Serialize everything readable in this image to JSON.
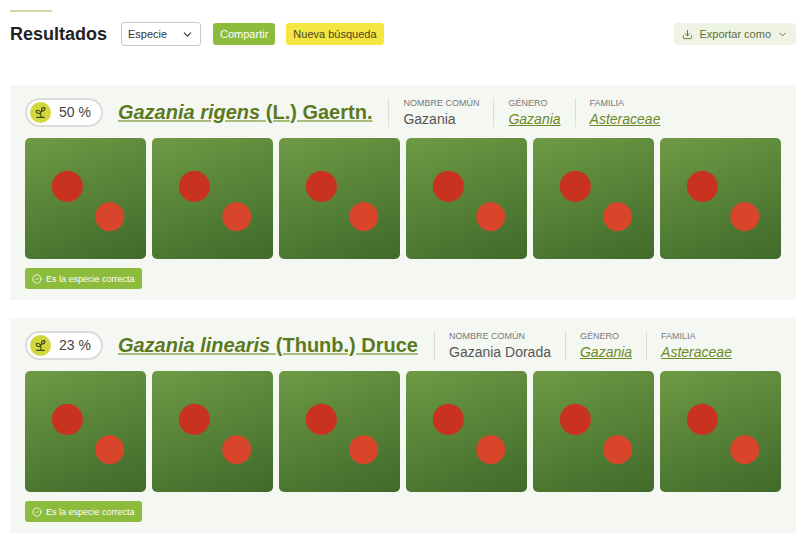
{
  "toolbar": {
    "title": "Resultados",
    "select": {
      "value": "Especie"
    },
    "share_button": "Compartir",
    "new_search_button": "Nueva búsqueda",
    "export_button": "Exportar como"
  },
  "results": [
    {
      "score": "50 %",
      "name": "Gazania rigens",
      "author": "(L.) Gaertn.",
      "fields": [
        {
          "label": "NOMBRE COMÚN",
          "value": "Gazania",
          "link": false
        },
        {
          "label": "GÉNERO",
          "value": "Gazania",
          "link": true
        },
        {
          "label": "FAMILIA",
          "value": "Asteraceae",
          "link": true
        }
      ],
      "photos": 6,
      "confirm_button": "Es la especie correcta"
    },
    {
      "score": "23 %",
      "name": "Gazania linearis",
      "author": "(Thunb.) Druce",
      "fields": [
        {
          "label": "NOMBRE COMÚN",
          "value": "Gazania Dorada",
          "link": false
        },
        {
          "label": "GÉNERO",
          "value": "Gazania",
          "link": true
        },
        {
          "label": "FAMILIA",
          "value": "Asteraceae",
          "link": true
        }
      ],
      "photos": 6,
      "confirm_button": "Es la especie correcta"
    }
  ]
}
